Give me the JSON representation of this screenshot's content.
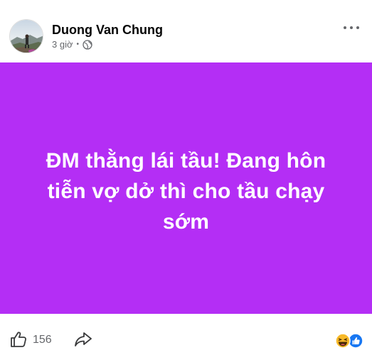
{
  "post": {
    "author": "Duong Van Chung",
    "time": "3 giờ",
    "privacy_icon": "globe-icon",
    "menu_icon": "more-options-icon",
    "text": "ĐM thằng lái tầu! Đang hôn tiễn vợ dở thì cho tầu chạy sớm",
    "background_color": "#b42ef5",
    "text_color": "#ffffff"
  },
  "footer": {
    "like_icon": "thumbs-up-icon",
    "like_count": "156",
    "share_icon": "share-icon",
    "reaction_icons": [
      "haha-reaction-icon",
      "like-reaction-icon"
    ]
  }
}
